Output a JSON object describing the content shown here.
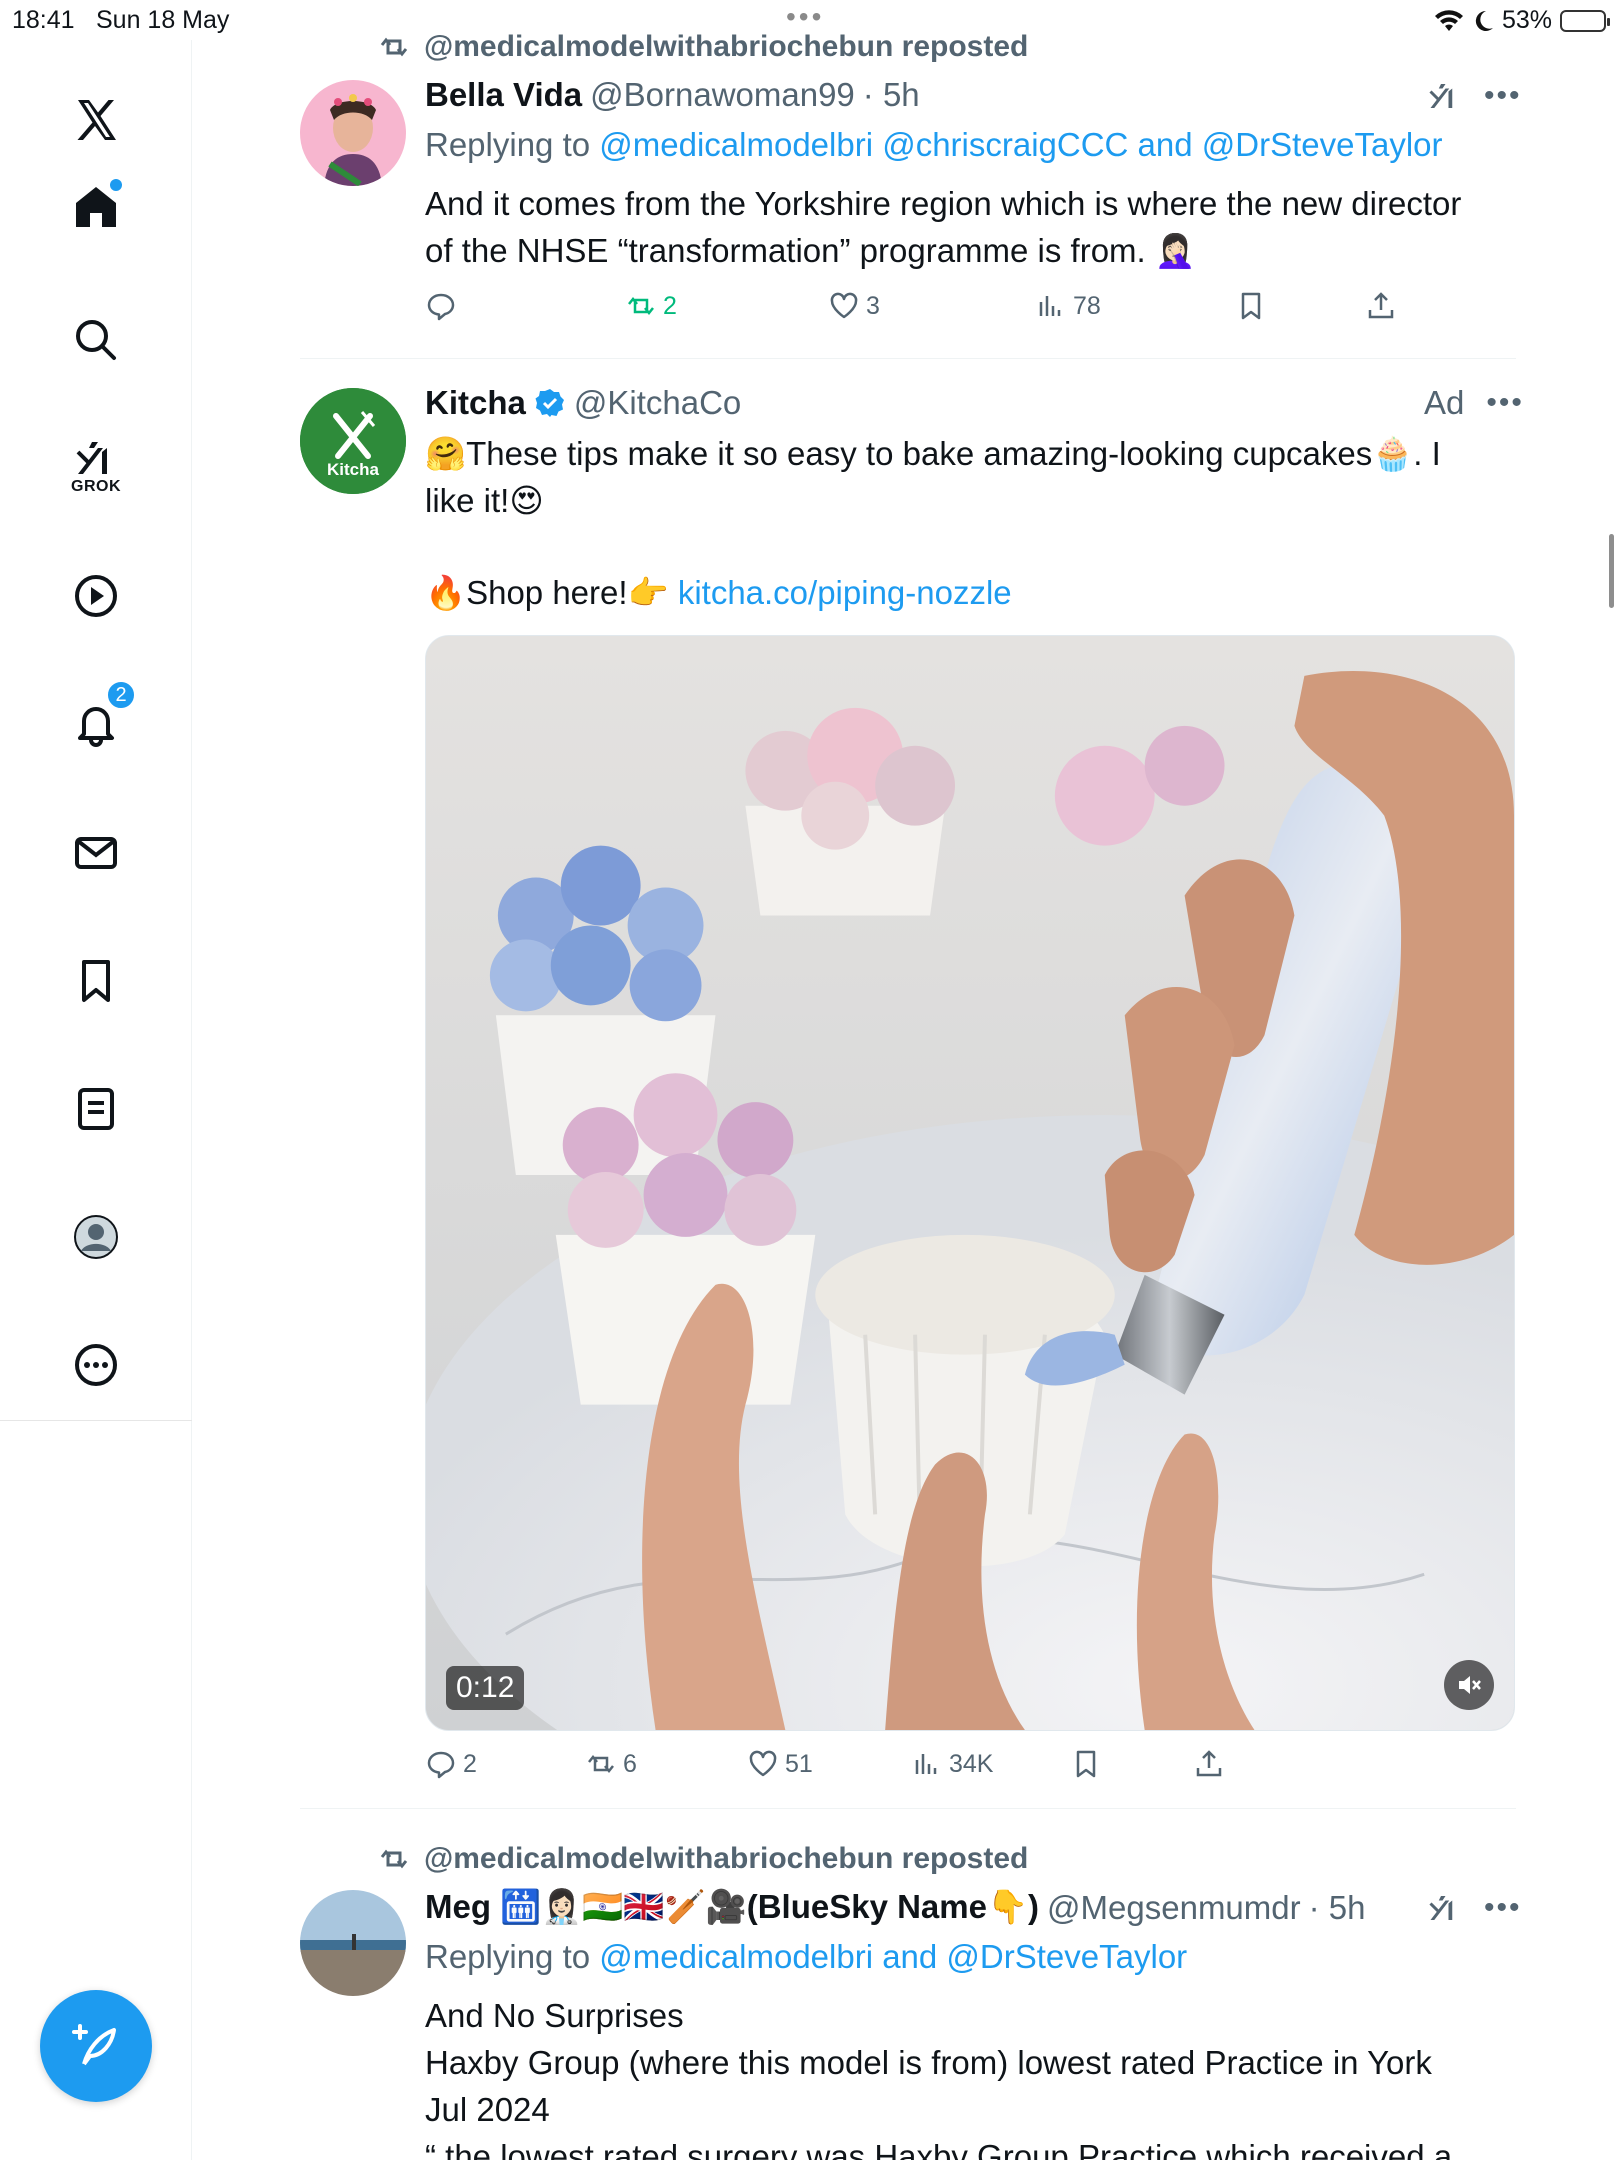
{
  "status_bar": {
    "time": "18:41",
    "date": "Sun 18 May",
    "battery": "53%",
    "battery_level": 0.53
  },
  "sidebar": {
    "notifications_badge": "2",
    "grok_label": "GROK"
  },
  "tweets": [
    {
      "repost_label": "@medicalmodelwithabriochebun reposted",
      "name": "Bella Vida",
      "handle": "@Bornawoman99",
      "time": "· 5h",
      "reply_prefix": "Replying to ",
      "reply_targets": "@medicalmodelbri @chriscraigCCC and @DrSteveTaylor",
      "text_line1": "And it comes from the Yorkshire region which is where the new director",
      "text_line2": "of the NHSE “transformation” programme is from. 🤦🏻‍♀️",
      "replies": "",
      "reposts": "2",
      "likes": "3",
      "views": "78"
    },
    {
      "name": "Kitcha",
      "handle": "@KitchaCo",
      "ad_label": "Ad",
      "avatar_text": "Kitcha",
      "text_line1": "🤗These tips make it so easy to bake amazing-looking cupcakes🧁. I",
      "text_line2": "like it!😍",
      "shop_text": "🔥Shop here!👉 ",
      "shop_link": "kitcha.co/piping-nozzle",
      "video_duration": "0:12",
      "replies": "2",
      "reposts": "6",
      "likes": "51",
      "views": "34K"
    },
    {
      "repost_label": "@medicalmodelwithabriochebun reposted",
      "name": "Meg 🛗👩🏻‍⚕️🇮🇳🇬🇧🏏🎥(BlueSky Name👇)",
      "handle": "@Megsenmumdr",
      "time": "· 5h",
      "reply_prefix": "Replying to ",
      "reply_targets": "@medicalmodelbri and @DrSteveTaylor",
      "text_line1": "And No Surprises",
      "text_line2": "Haxby Group (where this model is from) lowest rated Practice in York",
      "text_line3": "Jul 2024",
      "text_line4": "“ the lowest rated surgery was Haxby Group Practice which received a"
    }
  ],
  "colors": {
    "accent": "#1d9bf0",
    "repost_green": "#00ba7c",
    "muted": "#536471",
    "kitcha_green": "#2e8b3a"
  }
}
